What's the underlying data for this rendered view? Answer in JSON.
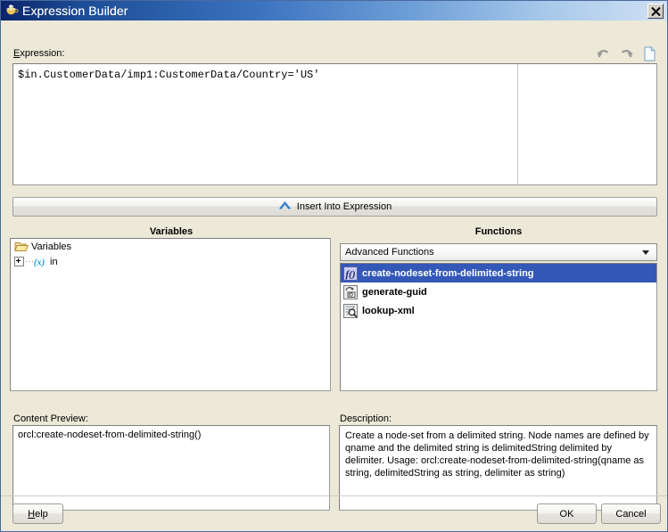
{
  "window": {
    "title": "Expression Builder",
    "icon": "java-coffee-cup-icon",
    "close_label": "×"
  },
  "expression_section": {
    "label": "Expression:",
    "label_mnemonic": "E",
    "value": "$in.CustomerData/imp1:CustomerData/Country='US'",
    "toolbar": [
      {
        "name": "undo-icon",
        "tooltip": "Undo"
      },
      {
        "name": "redo-icon",
        "tooltip": "Redo"
      },
      {
        "name": "new-document-icon",
        "tooltip": "Clear"
      }
    ]
  },
  "insert_button": {
    "label": "Insert Into Expression",
    "icon": "chevron-up-icon"
  },
  "variables_panel": {
    "title": "Variables",
    "tree": [
      {
        "label": "Variables",
        "icon": "folder-open-icon",
        "expandable": false,
        "depth": 0
      },
      {
        "label": "in",
        "icon": "variable-x-icon",
        "expandable": true,
        "expander": "+",
        "depth": 1
      }
    ]
  },
  "functions_panel": {
    "title": "Functions",
    "category_selected": "Advanced Functions",
    "category_options": [
      "Advanced Functions"
    ],
    "items": [
      {
        "label": "create-nodeset-from-delimited-string",
        "icon": "function-fx-icon",
        "selected": true
      },
      {
        "label": "generate-guid",
        "icon": "generate-guid-icon",
        "selected": false
      },
      {
        "label": "lookup-xml",
        "icon": "lookup-xml-icon",
        "selected": false
      }
    ]
  },
  "content_preview": {
    "label": "Content Preview:",
    "value": "orcl:create-nodeset-from-delimited-string()"
  },
  "description": {
    "label": "Description:",
    "value": "Create a node-set from a delimited string. Node names are defined by qname and the delimited string is delimitedString delimited by delimiter. Usage: orcl:create-nodeset-from-delimited-string(qname as string, delimitedString as string, delimiter as string)"
  },
  "footer": {
    "help_label": "Help",
    "help_mnemonic": "H",
    "ok_label": "OK",
    "cancel_label": "Cancel"
  },
  "colors": {
    "title_start": "#0a246a",
    "title_end": "#cfe0f3",
    "selection": "#3358b8",
    "dialog_bg": "#ece9d8",
    "accent_blue": "#1f6fc4"
  }
}
